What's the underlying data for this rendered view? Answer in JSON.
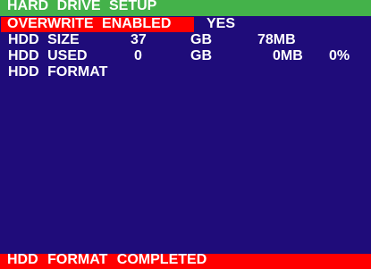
{
  "header": {
    "title": "HARD DRIVE SETUP"
  },
  "menu": {
    "overwrite": {
      "label": "OVERWRITE ENABLED",
      "value": "YES"
    },
    "hdd_size": {
      "label": "HDD SIZE",
      "value": "37",
      "unit": "GB",
      "extra": "78MB"
    },
    "hdd_used": {
      "label": "HDD USED",
      "value": "0",
      "unit": "GB",
      "extra": "0MB",
      "percent": "0%"
    },
    "hdd_format": {
      "label": "HDD FORMAT"
    }
  },
  "status": {
    "message": "HDD FORMAT COMPLETED"
  },
  "colors": {
    "background": "#1f0c7a",
    "header": "#44b24a",
    "highlight": "#ff0000",
    "status_bar": "#ff0000",
    "text": "#ffffff"
  }
}
